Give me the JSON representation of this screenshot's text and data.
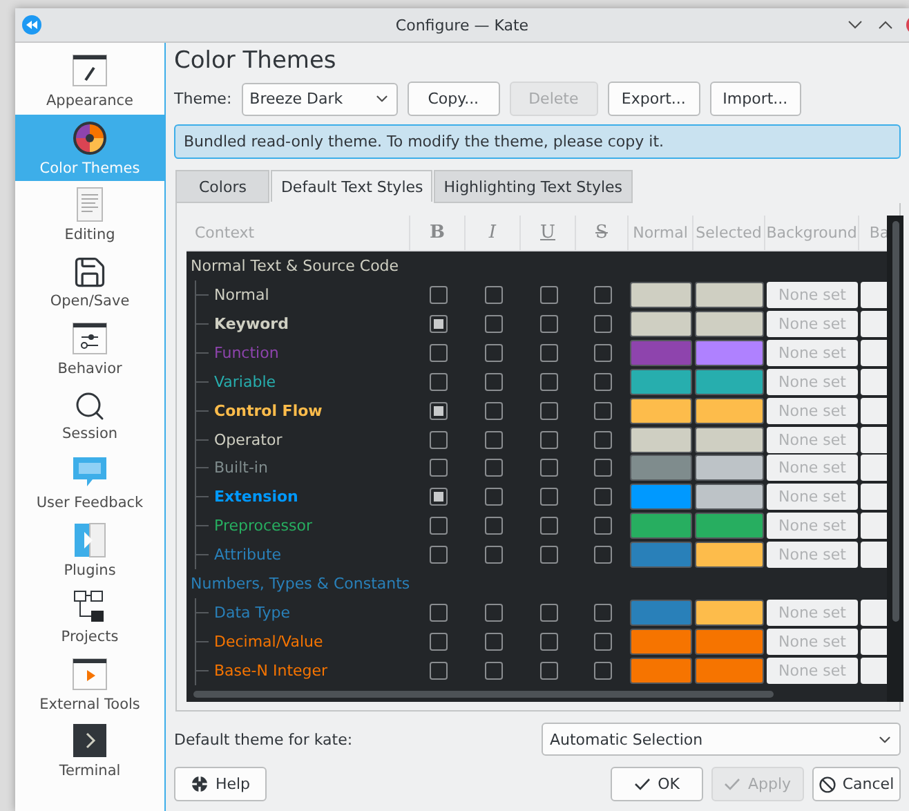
{
  "window": {
    "title": "Configure — Kate"
  },
  "sidebar": {
    "items": [
      {
        "label": "Appearance",
        "kind": "appearance",
        "selected": false
      },
      {
        "label": "Color Themes",
        "kind": "themes",
        "selected": true
      },
      {
        "label": "Editing",
        "kind": "editing",
        "selected": false
      },
      {
        "label": "Open/Save",
        "kind": "save",
        "selected": false
      },
      {
        "label": "Behavior",
        "kind": "behavior",
        "selected": false
      },
      {
        "label": "Session",
        "kind": "session",
        "selected": false
      },
      {
        "label": "User Feedback",
        "kind": "feedback",
        "selected": false
      },
      {
        "label": "Plugins",
        "kind": "plugins",
        "selected": false
      },
      {
        "label": "Projects",
        "kind": "projects",
        "selected": false
      },
      {
        "label": "External Tools",
        "kind": "tools",
        "selected": false
      },
      {
        "label": "Terminal",
        "kind": "terminal",
        "selected": false
      }
    ]
  },
  "page": {
    "title": "Color Themes",
    "theme_label": "Theme:",
    "theme_value": "Breeze Dark",
    "buttons": [
      {
        "label": "Copy...",
        "disabled": false
      },
      {
        "label": "Delete",
        "disabled": true
      },
      {
        "label": "Export...",
        "disabled": false
      },
      {
        "label": "Import...",
        "disabled": false
      }
    ],
    "info": "Bundled read-only theme. To modify the theme, please copy it."
  },
  "tabs": [
    {
      "label": "Colors",
      "selected": false
    },
    {
      "label": "Default Text Styles",
      "selected": true
    },
    {
      "label": "Highlighting Text Styles",
      "selected": false
    }
  ],
  "table": {
    "columns": [
      {
        "label": "Context",
        "kind": "text"
      },
      {
        "label": "B",
        "kind": "bold"
      },
      {
        "label": "I",
        "kind": "italic"
      },
      {
        "label": "U",
        "kind": "underline"
      },
      {
        "label": "S",
        "kind": "strike"
      },
      {
        "label": "Normal",
        "kind": "text"
      },
      {
        "label": "Selected",
        "kind": "text"
      },
      {
        "label": "Background",
        "kind": "text"
      },
      {
        "label": "Ba",
        "kind": "text"
      }
    ],
    "groups": [
      {
        "title": "Normal Text & Source Code",
        "color": "#cfcfc2",
        "children": [
          {
            "name": "Normal",
            "color": "#cfcfc2",
            "bold": false,
            "italic": false,
            "underline": false,
            "strikeout": false,
            "swatches": [
              {
                "color": "#cfcfc2"
              },
              {
                "color": "#cfcfc2"
              }
            ],
            "background": "None set"
          },
          {
            "name": "Keyword",
            "color": "#cfcfc2",
            "bold": true,
            "italic": false,
            "underline": false,
            "strikeout": false,
            "swatches": [
              {
                "color": "#cfcfc2"
              },
              {
                "color": "#cfcfc2"
              }
            ],
            "background": "None set"
          },
          {
            "name": "Function",
            "color": "#8e44ad",
            "bold": false,
            "italic": false,
            "underline": false,
            "strikeout": false,
            "swatches": [
              {
                "color": "#8e44ad"
              },
              {
                "color": "#af81ff"
              }
            ],
            "background": "None set"
          },
          {
            "name": "Variable",
            "color": "#27aeae",
            "bold": false,
            "italic": false,
            "underline": false,
            "strikeout": false,
            "swatches": [
              {
                "color": "#27aeae"
              },
              {
                "color": "#27aeae"
              }
            ],
            "background": "None set"
          },
          {
            "name": "Control Flow",
            "color": "#fdbc4b",
            "bold": true,
            "italic": false,
            "underline": false,
            "strikeout": false,
            "swatches": [
              {
                "color": "#fdbc4b"
              },
              {
                "color": "#fdbc4b"
              }
            ],
            "background": "None set"
          },
          {
            "name": "Operator",
            "color": "#cfcfc2",
            "bold": false,
            "italic": false,
            "underline": false,
            "strikeout": false,
            "swatches": [
              {
                "color": "#cfcfc2"
              },
              {
                "color": "#cfcfc2"
              }
            ],
            "background": "None set"
          },
          {
            "name": "Built-in",
            "color": "#7f8c8d",
            "bold": false,
            "italic": false,
            "underline": false,
            "strikeout": false,
            "swatches": [
              {
                "color": "#7f8c8d"
              },
              {
                "color": "#bdc3c7"
              }
            ],
            "background": "None set"
          },
          {
            "name": "Extension",
            "color": "#0099ff",
            "bold": true,
            "italic": false,
            "underline": false,
            "strikeout": false,
            "swatches": [
              {
                "color": "#0099ff"
              },
              {
                "color": "#bdc3c7"
              }
            ],
            "background": "None set"
          },
          {
            "name": "Preprocessor",
            "color": "#27ae60",
            "bold": false,
            "italic": false,
            "underline": false,
            "strikeout": false,
            "swatches": [
              {
                "color": "#27ae60"
              },
              {
                "color": "#27ae60"
              }
            ],
            "background": "None set"
          },
          {
            "name": "Attribute",
            "color": "#2980b9",
            "bold": false,
            "italic": false,
            "underline": false,
            "strikeout": false,
            "swatches": [
              {
                "color": "#2980b9"
              },
              {
                "color": "#fdbc4b"
              }
            ],
            "background": "None set"
          }
        ]
      },
      {
        "title": "Numbers, Types & Constants",
        "color": "#2980b9",
        "children": [
          {
            "name": "Data Type",
            "color": "#2980b9",
            "bold": false,
            "italic": false,
            "underline": false,
            "strikeout": false,
            "swatches": [
              {
                "color": "#2980b9"
              },
              {
                "color": "#fdbc4b"
              }
            ],
            "background": "None set"
          },
          {
            "name": "Decimal/Value",
            "color": "#f67400",
            "bold": false,
            "italic": false,
            "underline": false,
            "strikeout": false,
            "swatches": [
              {
                "color": "#f67400"
              },
              {
                "color": "#f67400"
              }
            ],
            "background": "None set"
          },
          {
            "name": "Base-N Integer",
            "color": "#f67400",
            "bold": false,
            "italic": false,
            "underline": false,
            "strikeout": false,
            "swatches": [
              {
                "color": "#f67400"
              },
              {
                "color": "#f67400"
              }
            ],
            "background": "None set"
          }
        ]
      }
    ]
  },
  "default_theme": {
    "label": "Default theme for kate:",
    "value": "Automatic Selection"
  },
  "footer": {
    "help": "Help",
    "buttons": [
      {
        "label": "OK",
        "kind": "ok",
        "disabled": false
      },
      {
        "label": "Apply",
        "kind": "apply",
        "disabled": true
      },
      {
        "label": "Cancel",
        "kind": "cancel",
        "disabled": false
      }
    ]
  }
}
